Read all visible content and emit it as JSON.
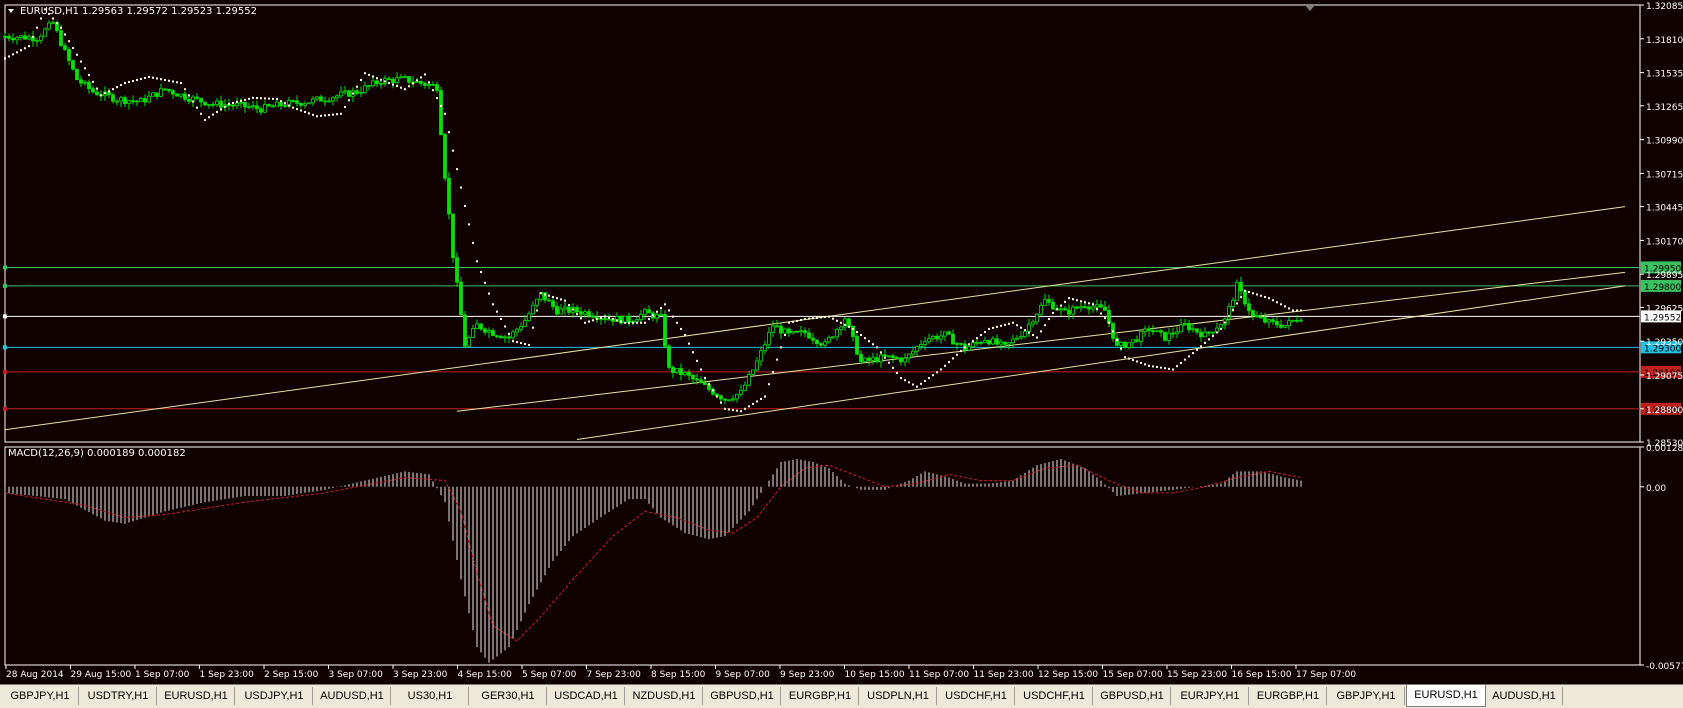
{
  "window": {
    "symbol_label": "EURUSD,H1",
    "ohlc": "1.29563 1.29572 1.29523 1.29552",
    "indicator_label": "MACD(12,26,9) 0.000189 0.000182"
  },
  "colors": {
    "background": "#100000",
    "frame": "#ffffff",
    "candle": "#00e100",
    "sar": "#ffffe0",
    "trendline": "#e8e4a0",
    "hline_green": "#3cc060",
    "hline_cyan": "#20c0e0",
    "hline_red": "#c02020",
    "macd_hist": "#e8e8e8",
    "macd_signal": "#cc2020"
  },
  "chart_data": [
    {
      "type": "candlestick",
      "symbol": "EURUSD",
      "timeframe": "H1",
      "ylim": [
        1.2853,
        1.32085
      ],
      "y_ticks": [
        "1.32085",
        "1.31810",
        "1.31535",
        "1.31265",
        "1.30990",
        "1.30715",
        "1.30445",
        "1.30170",
        "1.29895",
        "1.29625",
        "1.29350",
        "1.29075",
        "1.28800",
        "1.28530"
      ],
      "x_tick_labels": [
        "28 Aug 2014",
        "29 Aug 15:00",
        "1 Sep 07:00",
        "1 Sep 23:00",
        "2 Sep 15:00",
        "3 Sep 07:00",
        "3 Sep 23:00",
        "4 Sep 15:00",
        "5 Sep 07:00",
        "7 Sep 23:00",
        "8 Sep 15:00",
        "9 Sep 07:00",
        "9 Sep 23:00",
        "10 Sep 15:00",
        "11 Sep 07:00",
        "11 Sep 23:00",
        "12 Sep 15:00",
        "15 Sep 07:00",
        "15 Sep 23:00",
        "16 Sep 15:00",
        "17 Sep 07:00"
      ],
      "close_path": [
        [
          0,
          1.3183
        ],
        [
          8,
          1.3182
        ],
        [
          12,
          1.3194
        ],
        [
          15,
          1.317
        ],
        [
          18,
          1.3148
        ],
        [
          22,
          1.3138
        ],
        [
          28,
          1.3132
        ],
        [
          34,
          1.313
        ],
        [
          40,
          1.314
        ],
        [
          46,
          1.3133
        ],
        [
          52,
          1.3128
        ],
        [
          58,
          1.3127
        ],
        [
          64,
          1.3124
        ],
        [
          70,
          1.3128
        ],
        [
          76,
          1.313
        ],
        [
          82,
          1.3134
        ],
        [
          88,
          1.3138
        ],
        [
          94,
          1.3147
        ],
        [
          100,
          1.3148
        ],
        [
          104,
          1.3145
        ],
        [
          108,
          1.3142
        ],
        [
          110,
          1.307
        ],
        [
          112,
          1.3005
        ],
        [
          113,
          1.298
        ],
        [
          115,
          1.2932
        ],
        [
          118,
          1.2948
        ],
        [
          122,
          1.2942
        ],
        [
          126,
          1.2938
        ],
        [
          130,
          1.2952
        ],
        [
          134,
          1.2973
        ],
        [
          138,
          1.296
        ],
        [
          142,
          1.296
        ],
        [
          146,
          1.2958
        ],
        [
          150,
          1.2954
        ],
        [
          156,
          1.2952
        ],
        [
          160,
          1.2958
        ],
        [
          164,
          1.2954
        ],
        [
          166,
          1.2912
        ],
        [
          170,
          1.2908
        ],
        [
          175,
          1.2898
        ],
        [
          180,
          1.2888
        ],
        [
          184,
          1.2893
        ],
        [
          188,
          1.2918
        ],
        [
          192,
          1.2948
        ],
        [
          196,
          1.294
        ],
        [
          200,
          1.2942
        ],
        [
          205,
          1.2932
        ],
        [
          210,
          1.2954
        ],
        [
          214,
          1.2918
        ],
        [
          220,
          1.2922
        ],
        [
          225,
          1.292
        ],
        [
          230,
          1.2937
        ],
        [
          235,
          1.294
        ],
        [
          240,
          1.2929
        ],
        [
          245,
          1.2937
        ],
        [
          250,
          1.293
        ],
        [
          255,
          1.2944
        ],
        [
          260,
          1.2968
        ],
        [
          265,
          1.2958
        ],
        [
          270,
          1.2965
        ],
        [
          275,
          1.296
        ],
        [
          278,
          1.293
        ],
        [
          282,
          1.2935
        ],
        [
          286,
          1.2945
        ],
        [
          290,
          1.2938
        ],
        [
          295,
          1.2948
        ],
        [
          300,
          1.294
        ],
        [
          305,
          1.2952
        ],
        [
          308,
          1.298
        ],
        [
          312,
          1.2955
        ],
        [
          316,
          1.295
        ],
        [
          320,
          1.2948
        ],
        [
          324,
          1.2955
        ]
      ],
      "series": [
        {
          "name": "Parabolic SAR",
          "points": [
            [
              0,
              1.3165
            ],
            [
              6,
              1.3175
            ],
            [
              10,
              1.3205
            ],
            [
              14,
              1.319
            ],
            [
              18,
              1.3168
            ],
            [
              24,
              1.3135
            ],
            [
              30,
              1.3145
            ],
            [
              36,
              1.315
            ],
            [
              44,
              1.3145
            ],
            [
              50,
              1.3115
            ],
            [
              56,
              1.3128
            ],
            [
              62,
              1.3133
            ],
            [
              68,
              1.3132
            ],
            [
              72,
              1.3125
            ],
            [
              78,
              1.3118
            ],
            [
              84,
              1.312
            ],
            [
              90,
              1.3153
            ],
            [
              96,
              1.3145
            ],
            [
              100,
              1.314
            ],
            [
              105,
              1.3152
            ],
            [
              110,
              1.312
            ],
            [
              114,
              1.306
            ],
            [
              118,
              1.3
            ],
            [
              122,
              1.2965
            ],
            [
              127,
              1.2935
            ],
            [
              131,
              1.2932
            ],
            [
              134,
              1.2974
            ],
            [
              140,
              1.2968
            ],
            [
              145,
              1.295
            ],
            [
              150,
              1.2955
            ],
            [
              155,
              1.295
            ],
            [
              160,
              1.295
            ],
            [
              165,
              1.2965
            ],
            [
              170,
              1.294
            ],
            [
              175,
              1.2905
            ],
            [
              180,
              1.288
            ],
            [
              184,
              1.2878
            ],
            [
              190,
              1.289
            ],
            [
              196,
              1.295
            ],
            [
              200,
              1.2953
            ],
            [
              206,
              1.2955
            ],
            [
              212,
              1.2945
            ],
            [
              218,
              1.293
            ],
            [
              224,
              1.2905
            ],
            [
              228,
              1.2898
            ],
            [
              234,
              1.2912
            ],
            [
              240,
              1.293
            ],
            [
              246,
              1.2945
            ],
            [
              252,
              1.295
            ],
            [
              258,
              1.2938
            ],
            [
              262,
              1.2958
            ],
            [
              266,
              1.297
            ],
            [
              272,
              1.2965
            ],
            [
              276,
              1.295
            ],
            [
              280,
              1.2922
            ],
            [
              286,
              1.2915
            ],
            [
              292,
              1.2912
            ],
            [
              298,
              1.2928
            ],
            [
              304,
              1.2945
            ],
            [
              310,
              1.2976
            ],
            [
              316,
              1.297
            ],
            [
              322,
              1.296
            ]
          ]
        }
      ],
      "horizontal_levels": [
        {
          "price": 1.2995,
          "label": "1.29950",
          "color": "#3cc060"
        },
        {
          "price": 1.298,
          "label": "1.29800",
          "color": "#3cc060"
        },
        {
          "price": 1.29552,
          "label": "1.29552",
          "color": "#ffffff"
        },
        {
          "price": 1.293,
          "label": "1.29300",
          "color": "#20c0e0"
        },
        {
          "price": 1.291,
          "label": "1.29100",
          "color": "#c02020"
        },
        {
          "price": 1.288,
          "label": "1.28800",
          "color": "#c02020"
        }
      ],
      "trendlines": [
        {
          "from": [
            0,
            1.2863
          ],
          "to": [
            405,
            1.30445
          ]
        },
        {
          "from": [
            143,
            1.2855
          ],
          "to": [
            405,
            1.298
          ]
        },
        {
          "from": [
            113,
            1.2878
          ],
          "to": [
            405,
            1.2991
          ]
        }
      ]
    },
    {
      "type": "bar",
      "name": "MACD(12,26,9)",
      "ylim": [
        -0.005775,
        0.001288
      ],
      "y_ticks": [
        "0.001288",
        "0.00",
        "-0.005775"
      ],
      "values_path": [
        [
          0,
          -0.0002
        ],
        [
          15,
          -0.0004
        ],
        [
          25,
          -0.0011
        ],
        [
          30,
          -0.0012
        ],
        [
          40,
          -0.0008
        ],
        [
          50,
          -0.0005
        ],
        [
          60,
          -0.0003
        ],
        [
          70,
          -0.0003
        ],
        [
          80,
          -0.0001
        ],
        [
          90,
          0.0002
        ],
        [
          100,
          0.0005
        ],
        [
          106,
          0.0004
        ],
        [
          110,
          -0.0005
        ],
        [
          114,
          -0.003
        ],
        [
          118,
          -0.0052
        ],
        [
          121,
          -0.0057
        ],
        [
          126,
          -0.0052
        ],
        [
          131,
          -0.0038
        ],
        [
          137,
          -0.0024
        ],
        [
          142,
          -0.0016
        ],
        [
          150,
          -0.0009
        ],
        [
          156,
          -0.0004
        ],
        [
          160,
          -0.0004
        ],
        [
          164,
          -0.001
        ],
        [
          170,
          -0.0015
        ],
        [
          176,
          -0.0017
        ],
        [
          180,
          -0.0016
        ],
        [
          186,
          -0.0008
        ],
        [
          190,
          0.0
        ],
        [
          194,
          0.0008
        ],
        [
          198,
          0.0009
        ],
        [
          202,
          0.0008
        ],
        [
          206,
          0.0006
        ],
        [
          210,
          0.0001
        ],
        [
          214,
          -0.0001
        ],
        [
          220,
          -0.0001
        ],
        [
          226,
          0.0002
        ],
        [
          230,
          0.0005
        ],
        [
          236,
          0.0003
        ],
        [
          240,
          0.0001
        ],
        [
          246,
          0.0001
        ],
        [
          252,
          0.0002
        ],
        [
          258,
          0.0007
        ],
        [
          264,
          0.0009
        ],
        [
          270,
          0.0006
        ],
        [
          274,
          0.0002
        ],
        [
          278,
          -0.0003
        ],
        [
          285,
          -0.0002
        ],
        [
          292,
          -0.0001
        ],
        [
          298,
          0.0
        ],
        [
          304,
          0.0001
        ],
        [
          308,
          0.0005
        ],
        [
          314,
          0.0005
        ],
        [
          320,
          0.0003
        ],
        [
          324,
          0.0002
        ]
      ],
      "signal_path": [
        [
          0,
          -0.0002
        ],
        [
          20,
          -0.0006
        ],
        [
          30,
          -0.001
        ],
        [
          40,
          -0.0009
        ],
        [
          60,
          -0.0005
        ],
        [
          80,
          -0.0002
        ],
        [
          100,
          0.0003
        ],
        [
          110,
          0.0002
        ],
        [
          114,
          -0.0008
        ],
        [
          118,
          -0.0028
        ],
        [
          122,
          -0.0045
        ],
        [
          128,
          -0.005
        ],
        [
          134,
          -0.0042
        ],
        [
          142,
          -0.003
        ],
        [
          152,
          -0.0016
        ],
        [
          160,
          -0.0008
        ],
        [
          168,
          -0.001
        ],
        [
          176,
          -0.0014
        ],
        [
          182,
          -0.0015
        ],
        [
          188,
          -0.001
        ],
        [
          194,
          0.0
        ],
        [
          200,
          0.0006
        ],
        [
          206,
          0.0007
        ],
        [
          212,
          0.0004
        ],
        [
          220,
          0.0
        ],
        [
          228,
          0.0001
        ],
        [
          236,
          0.0004
        ],
        [
          244,
          0.0002
        ],
        [
          252,
          0.0002
        ],
        [
          260,
          0.0006
        ],
        [
          268,
          0.0007
        ],
        [
          276,
          0.0002
        ],
        [
          284,
          -0.0002
        ],
        [
          292,
          -0.0002
        ],
        [
          300,
          0.0
        ],
        [
          308,
          0.0003
        ],
        [
          316,
          0.0005
        ],
        [
          324,
          0.0003
        ]
      ]
    }
  ],
  "tabs": [
    {
      "label": "GBPJPY,H1",
      "active": false
    },
    {
      "label": "USDTRY,H1",
      "active": false
    },
    {
      "label": "EURUSD,H1",
      "active": false
    },
    {
      "label": "USDJPY,H1",
      "active": false
    },
    {
      "label": "AUDUSD,H1",
      "active": false
    },
    {
      "label": "US30,H1",
      "active": false
    },
    {
      "label": "GER30,H1",
      "active": false
    },
    {
      "label": "USDCAD,H1",
      "active": false
    },
    {
      "label": "NZDUSD,H1",
      "active": false
    },
    {
      "label": "GBPUSD,H1",
      "active": false
    },
    {
      "label": "EURGBP,H1",
      "active": false
    },
    {
      "label": "USDPLN,H1",
      "active": false
    },
    {
      "label": "USDCHF,H1",
      "active": false
    },
    {
      "label": "USDCHF,H1",
      "active": false
    },
    {
      "label": "GBPUSD,H1",
      "active": false
    },
    {
      "label": "EURJPY,H1",
      "active": false
    },
    {
      "label": "EURGBP,H1",
      "active": false
    },
    {
      "label": "GBPJPY,H1",
      "active": false
    },
    {
      "label": "EURUSD,H1",
      "active": true
    },
    {
      "label": "AUDUSD,H1",
      "active": false
    }
  ]
}
